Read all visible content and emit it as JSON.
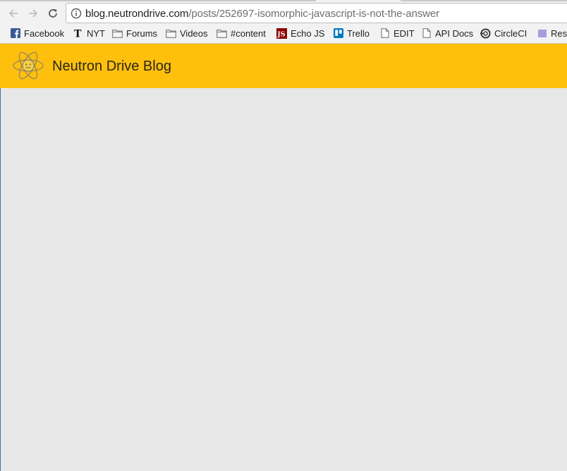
{
  "browser": {
    "url_host": "blog.neutrondrive.com",
    "url_path": "/posts/252697-isomorphic-javascript-is-not-the-answer"
  },
  "bookmarks": [
    {
      "label": "Facebook",
      "icon": "facebook-icon"
    },
    {
      "label": "NYT",
      "icon": "nyt-icon"
    },
    {
      "label": "Forums",
      "icon": "folder-icon"
    },
    {
      "label": "Videos",
      "icon": "folder-icon"
    },
    {
      "label": "#content",
      "icon": "folder-icon"
    },
    {
      "label": "Echo JS",
      "icon": "echojs-icon"
    },
    {
      "label": "Trello",
      "icon": "trello-icon"
    },
    {
      "label": "EDIT",
      "icon": "page-icon"
    },
    {
      "label": "API Docs",
      "icon": "page-icon"
    },
    {
      "label": "CircleCI",
      "icon": "circleci-icon"
    },
    {
      "label": "Reso",
      "icon": "bookmark-icon"
    }
  ],
  "echojs_badge": "JS",
  "blog": {
    "title": "Neutron Drive Blog",
    "accent_color": "#fec00d"
  },
  "colors": {
    "page_background": "#e7e7e7",
    "facebook": "#3b5998",
    "echojs": "#8b0000",
    "trello": "#0079bf",
    "reso": "#a99bdc"
  }
}
